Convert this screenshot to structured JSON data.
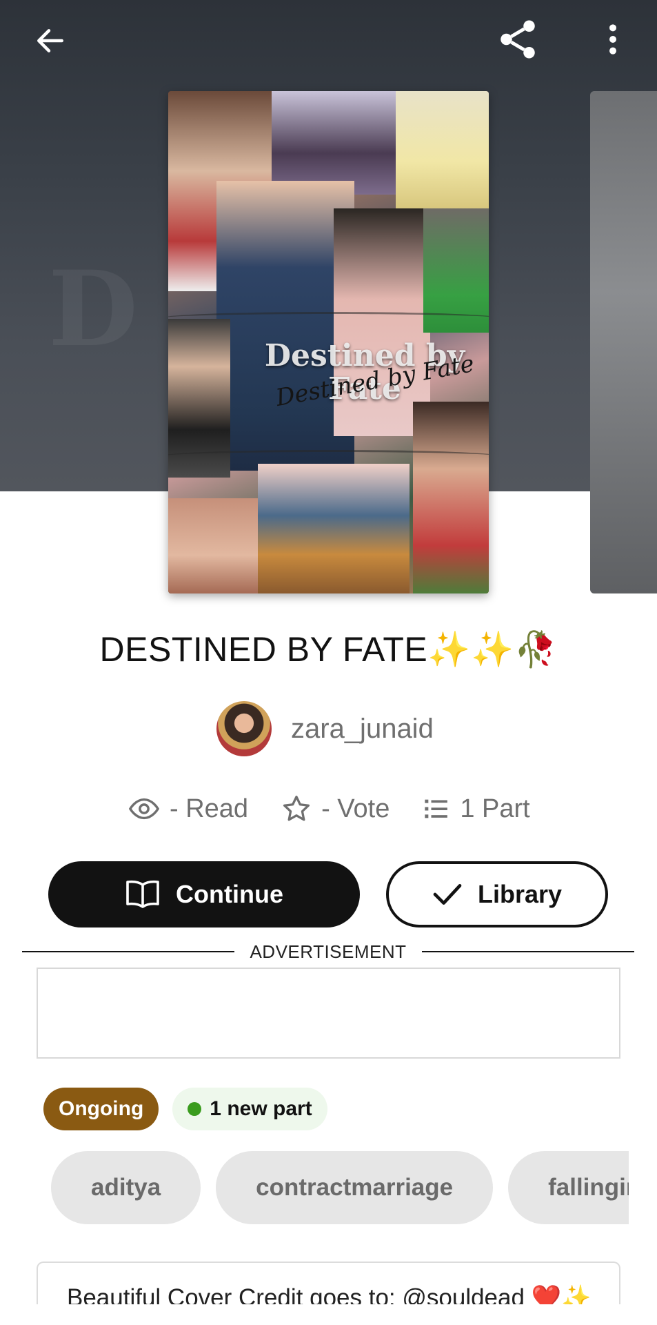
{
  "header": {
    "back_icon": "arrow-left-icon",
    "share_icon": "share-icon",
    "more_icon": "more-vertical-icon"
  },
  "cover": {
    "title_line": "Destined by Fate",
    "script_line": "Destined by Fate"
  },
  "story": {
    "title": "DESTINED BY FATE✨✨🥀",
    "author": "zara_junaid"
  },
  "stats": {
    "reads": "- Read",
    "votes": "- Vote",
    "parts": "1 Part"
  },
  "actions": {
    "continue_label": "Continue",
    "library_label": "Library"
  },
  "advertisement": {
    "label": "ADVERTISEMENT"
  },
  "status": {
    "state": "Ongoing",
    "new_parts": "1 new part"
  },
  "tags": [
    "aditya",
    "contractmarriage",
    "fallinginlove"
  ],
  "description": {
    "text": "Beautiful Cover Credit goes to: @souldead ❤️✨"
  },
  "colors": {
    "status_badge": "#8a5a12",
    "new_part_dot": "#3a9c1e",
    "primary_button": "#121212"
  }
}
